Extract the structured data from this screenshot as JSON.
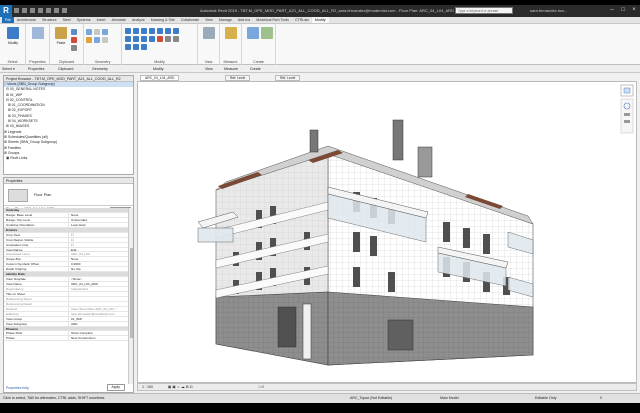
{
  "titlebar": {
    "logo": "R",
    "title": "Autodesk Revit 2019 - TBT.M_OPE_MOD_PART_A21_ALL_COOD_ALL_R2_sara.fernandez@modernist.com - Floor Plan: ARC_04_L04_ARD",
    "search_placeholder": "Type a keyword or phrase",
    "user": "sara.fernandez.hzz..."
  },
  "ribbon_tabs": [
    "File",
    "Architecture",
    "Structure",
    "Steel",
    "Systems",
    "Insert",
    "Annotate",
    "Analyze",
    "Massing & Site",
    "Collaborate",
    "View",
    "Manage",
    "Add-Ins",
    "Modelical Rich Tools",
    "CTRLaix",
    "Modify"
  ],
  "ribbon": {
    "select_label": "Select",
    "properties_label": "Properties",
    "clipboard_label": "Clipboard",
    "geometry_label": "Geometry",
    "modify_label": "Modify",
    "view_label": "View",
    "measure_label": "Measure",
    "create_label": "Create",
    "modify_btn": "Modify",
    "paste_btn": "Paste",
    "cope_btn": "Cope",
    "cut_btn": "Cut",
    "join_btn": "Join"
  },
  "options_bar": {
    "select": "Select ▾",
    "properties": "Properties",
    "clipboard": "Clipboard",
    "geometry": "Geometry",
    "modify": "Modify",
    "view": "View",
    "measure": "Measure",
    "create": "Create"
  },
  "project_browser": {
    "title": "Project Browser - TBT.M_OPE_MOD_PART_A21_ALL_COOD_ALL_R2",
    "items": [
      "□ Views (SBN_Group Subgroup)",
      "  ⊟ 00_GENERAL NOTES",
      "  ⊞ 01_WIP",
      "  ⊟ 02_CONTROL",
      "    ⊞ 01_COORDINATION",
      "    ⊞ 02_EXPORT",
      "    ⊞ 03_PHASES",
      "    ⊞ 04_WORKSETS",
      "  ⊞ 03_IMAGES",
      "⊞ Legends",
      "⊞ Schedules/Quantities (all)",
      "⊞ Sheets (SBN_Group Subgroup)",
      "⊞ Families",
      "⊞ Groups",
      "  ▣ Revit Links"
    ]
  },
  "properties": {
    "title": "Properties",
    "type_name": "Floor Plan",
    "instance_label": "Floor Plan: ARC_04_L04_ARD",
    "edit_type": "Edit Type",
    "rows": [
      {
        "k": "Underlay",
        "v": "",
        "cat": true
      },
      {
        "k": "Range: Base Level",
        "v": "None"
      },
      {
        "k": "Range: Top Level",
        "v": "Unbounded"
      },
      {
        "k": "Underlay Orientation",
        "v": "Look down"
      },
      {
        "k": "Extents",
        "v": "",
        "cat": true
      },
      {
        "k": "Crop View",
        "v": "☐"
      },
      {
        "k": "Crop Region Visible",
        "v": "☐"
      },
      {
        "k": "Annotation Crop",
        "v": "☐"
      },
      {
        "k": "View Range",
        "v": "Edit..."
      },
      {
        "k": "Associated Level",
        "v": "ARC_04_L04",
        "dim": true
      },
      {
        "k": "Scope Box",
        "v": "None"
      },
      {
        "k": "Column Symbolic Offset",
        "v": "0.0000"
      },
      {
        "k": "Depth Clipping",
        "v": "No clip"
      },
      {
        "k": "Identity Data",
        "v": "",
        "cat": true
      },
      {
        "k": "View Template",
        "v": "<None>"
      },
      {
        "k": "View Name",
        "v": "ARC_04_L04_ARD"
      },
      {
        "k": "Dependency",
        "v": "Independent",
        "dim": true
      },
      {
        "k": "Title on Sheet",
        "v": ""
      },
      {
        "k": "Referencing Sheet",
        "v": "",
        "dim": true
      },
      {
        "k": "Referencing Detail",
        "v": "",
        "dim": true
      },
      {
        "k": "Workset",
        "v": "View \"Floor Plan: ARC_04_L04...\"",
        "dim": true
      },
      {
        "k": "Edited by",
        "v": "sara.fernandez@modelical.com",
        "dim": true
      },
      {
        "k": "View Group",
        "v": "01_WIP"
      },
      {
        "k": "View Subgroup",
        "v": "ARD"
      },
      {
        "k": "Phasing",
        "v": "",
        "cat": true
      },
      {
        "k": "Phase Filter",
        "v": "Show Complete"
      },
      {
        "k": "Phase",
        "v": "New Construction"
      }
    ],
    "help": "Properties help",
    "apply": "Apply"
  },
  "view_tabs": {
    "active": "ARC_04_L04_ARD",
    "tab2": "Ref. Level",
    "tab3": "Ref. Level"
  },
  "view_control": {
    "scale": "1 : 100",
    "worksets": "ARC_Topaz (Not Editable)"
  },
  "status": {
    "hint": "Click to select, TAB for alternates, CTRL adds, SHIFT unselects.",
    "model": "Main Model",
    "editable": "Editable Only",
    "filter": "0"
  }
}
